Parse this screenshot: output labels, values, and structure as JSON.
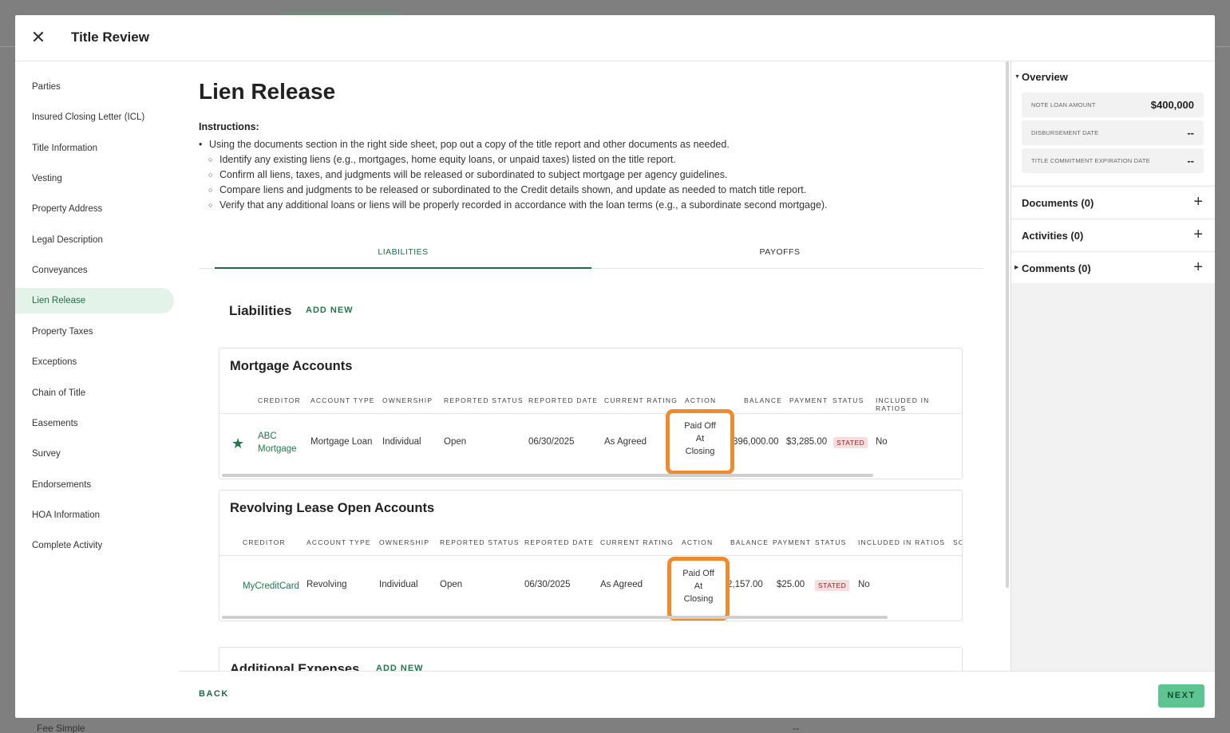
{
  "background": {
    "bottom_text": "Fee Simple",
    "bottom_value": "--"
  },
  "header": {
    "title": "Title Review",
    "close_icon": "close-icon"
  },
  "nav": {
    "items": [
      {
        "label": "Parties"
      },
      {
        "label": "Insured Closing Letter (ICL)"
      },
      {
        "label": "Title Information"
      },
      {
        "label": "Vesting"
      },
      {
        "label": "Property Address"
      },
      {
        "label": "Legal Description"
      },
      {
        "label": "Conveyances"
      },
      {
        "label": "Lien Release",
        "active": true
      },
      {
        "label": "Property Taxes"
      },
      {
        "label": "Exceptions"
      },
      {
        "label": "Chain of Title"
      },
      {
        "label": "Easements"
      },
      {
        "label": "Survey"
      },
      {
        "label": "Endorsements"
      },
      {
        "label": "HOA Information"
      },
      {
        "label": "Complete Activity"
      }
    ]
  },
  "main": {
    "title": "Lien Release",
    "instructions_title": "Instructions:",
    "instructions": [
      "Using the documents section in the right side sheet, pop out a copy of the title report and other documents as needed.",
      "Identify any existing liens (e.g., mortgages, home equity loans, or unpaid taxes) listed on the title report.",
      "Confirm all liens, taxes, and judgments will be released or subordinated to subject mortgage per agency guidelines.",
      "Compare liens and judgments to be released or subordinated to the Credit details shown, and update as needed to match title report.",
      "Verify that any additional loans or liens will be properly recorded in accordance with the loan terms (e.g., a subordinate second mortgage)."
    ],
    "tabs": [
      "LIABILITIES",
      "PAYOFFS"
    ],
    "liabilities_title": "Liabilities",
    "add_new": "ADD NEW",
    "mortgage": {
      "title": "Mortgage Accounts",
      "columns": [
        "CREDITOR",
        "ACCOUNT TYPE",
        "OWNERSHIP",
        "REPORTED STATUS",
        "REPORTED DATE",
        "CURRENT RATING",
        "ACTION",
        "BALANCE",
        "PAYMENT",
        "STATUS",
        "INCLUDED IN RATIOS"
      ],
      "row": {
        "creditor_line1": "ABC",
        "creditor_line2": "Mortgage",
        "account_type": "Mortgage Loan",
        "ownership": "Individual",
        "reported_status": "Open",
        "reported_date": "06/30/2025",
        "current_rating": "As Agreed",
        "action_line1": "Paid Off",
        "action_line2": "At",
        "action_line3": "Closing",
        "balance": "396,000.00",
        "payment": "$3,285.00",
        "status": "STATED",
        "included": "No"
      }
    },
    "revolving": {
      "title": "Revolving Lease Open Accounts",
      "columns": [
        "CREDITOR",
        "ACCOUNT TYPE",
        "OWNERSHIP",
        "REPORTED STATUS",
        "REPORTED DATE",
        "CURRENT RATING",
        "ACTION",
        "BALANCE",
        "PAYMENT",
        "STATUS",
        "INCLUDED IN RATIOS",
        "SO"
      ],
      "row": {
        "creditor": "MyCreditCard",
        "account_type": "Revolving",
        "ownership": "Individual",
        "reported_status": "Open",
        "reported_date": "06/30/2025",
        "current_rating": "As Agreed",
        "action_line1": "Paid Off",
        "action_line2": "At",
        "action_line3": "Closing",
        "balance": "2,157.00",
        "payment": "$25.00",
        "status": "STATED",
        "included": "No"
      }
    },
    "additional": {
      "title": "Additional Expenses"
    }
  },
  "footer": {
    "back": "BACK",
    "next": "NEXT"
  },
  "right_panel": {
    "overview": {
      "title": "Overview",
      "fields": [
        {
          "label": "NOTE LOAN AMOUNT",
          "value": "$400,000"
        },
        {
          "label": "DISBURSEMENT DATE",
          "value": "--"
        },
        {
          "label": "TITLE COMMITMENT EXPIRATION DATE",
          "value": "--"
        }
      ]
    },
    "documents": "Documents (0)",
    "activities": "Activities (0)",
    "comments": "Comments (0)"
  },
  "colors": {
    "accent": "#1e7a4e",
    "highlight": "#ef8a2d",
    "active_nav_bg": "#e4f3ea",
    "next_bg": "#5ec492"
  }
}
